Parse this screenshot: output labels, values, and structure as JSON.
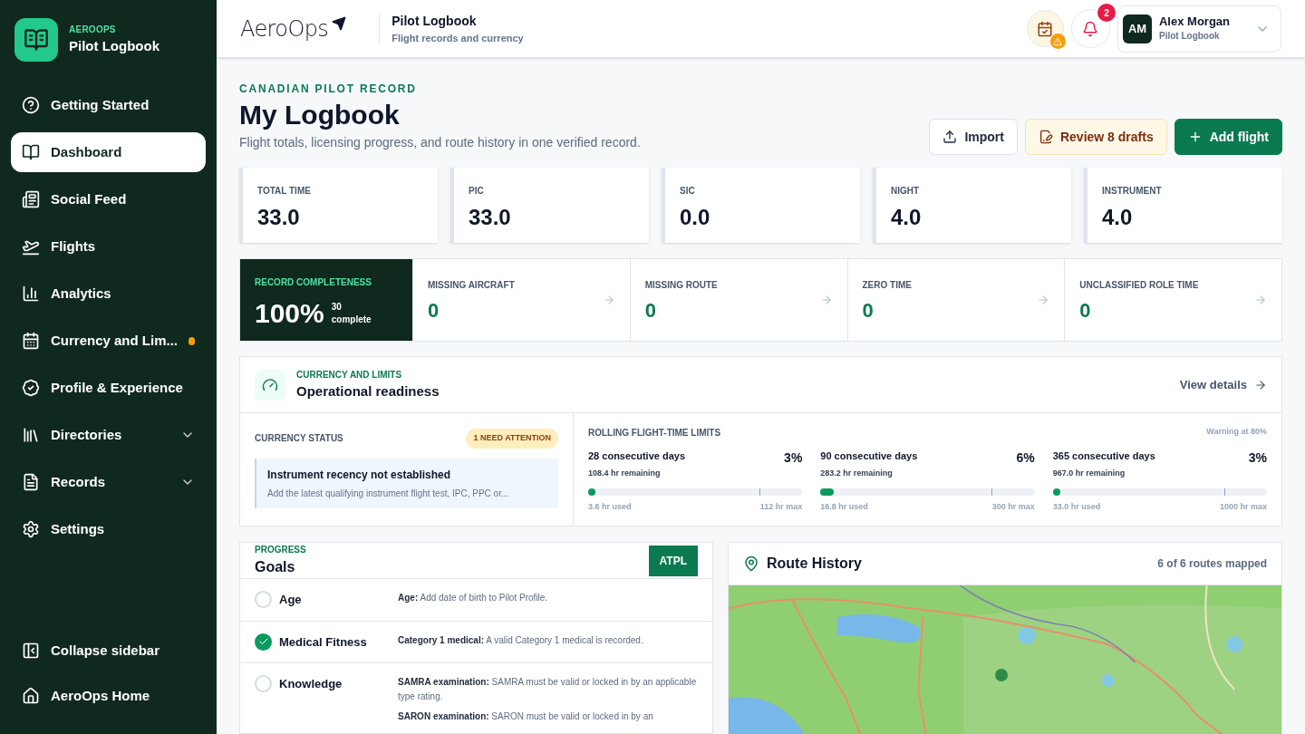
{
  "sidebar": {
    "brand": {
      "eyebrow": "AEROOPS",
      "title": "Pilot Logbook"
    },
    "items": [
      {
        "label": "Getting Started",
        "selected": false
      },
      {
        "label": "Dashboard",
        "selected": true
      },
      {
        "label": "Social Feed",
        "selected": false
      },
      {
        "label": "Flights",
        "selected": false
      },
      {
        "label": "Analytics",
        "selected": false
      },
      {
        "label": "Currency and Lim...",
        "selected": false,
        "alert": true
      },
      {
        "label": "Profile & Experience",
        "selected": false
      },
      {
        "label": "Directories",
        "selected": false,
        "expandable": true
      },
      {
        "label": "Records",
        "selected": false,
        "expandable": true
      },
      {
        "label": "Settings",
        "selected": false
      }
    ],
    "footer": [
      {
        "label": "Collapse sidebar"
      },
      {
        "label": "AeroOps Home"
      }
    ]
  },
  "header": {
    "logo": "AeroOps",
    "title": "Pilot Logbook",
    "subtitle": "Flight records and currency",
    "notifications": "2",
    "user": {
      "initials": "AM",
      "name": "Alex Morgan",
      "role": "Pilot Logbook"
    }
  },
  "page": {
    "eyebrow": "CANADIAN PILOT RECORD",
    "title": "My Logbook",
    "subtitle": "Flight totals, licensing progress, and route history in one verified record.",
    "buttons": [
      {
        "label": "Import",
        "kind": "outline"
      },
      {
        "label": "Review 8 drafts",
        "kind": "warning"
      },
      {
        "label": "Add flight",
        "kind": "primary"
      }
    ]
  },
  "totals": [
    {
      "label": "TOTAL TIME",
      "value": "33.0"
    },
    {
      "label": "PIC",
      "value": "33.0"
    },
    {
      "label": "SIC",
      "value": "0.0"
    },
    {
      "label": "NIGHT",
      "value": "4.0"
    },
    {
      "label": "INSTRUMENT",
      "value": "4.0"
    }
  ],
  "completeness": {
    "label": "RECORD COMPLETENESS",
    "value": "100%",
    "count": "30",
    "count_label": "complete"
  },
  "issues": [
    {
      "label": "MISSING AIRCRAFT",
      "value": "0"
    },
    {
      "label": "MISSING ROUTE",
      "value": "0"
    },
    {
      "label": "ZERO TIME",
      "value": "0"
    },
    {
      "label": "UNCLASSIFIED ROLE TIME",
      "value": "0"
    }
  ],
  "readiness": {
    "eyebrow": "CURRENCY AND LIMITS",
    "title": "Operational readiness",
    "link": "View details",
    "currency": {
      "label": "CURRENCY STATUS",
      "badge": "1 NEED ATTENTION",
      "alert": {
        "title": "Instrument recency not established",
        "text": "Add the latest qualifying instrument flight test, IPC, PPC or..."
      }
    },
    "limits": {
      "label": "ROLLING FLIGHT-TIME LIMITS",
      "note": "Warning at 80%",
      "items": [
        {
          "title": "28 consecutive days",
          "percent": "3%",
          "remaining": "108.4 hr remaining",
          "level": 0.03,
          "used": "3.6 hr used",
          "max": "112 hr max"
        },
        {
          "title": "90 consecutive days",
          "percent": "6%",
          "remaining": "283.2 hr remaining",
          "level": 0.06,
          "used": "16.8 hr used",
          "max": "300 hr max"
        },
        {
          "title": "365 consecutive days",
          "percent": "3%",
          "remaining": "967.0 hr remaining",
          "level": 0.03,
          "used": "33.0 hr used",
          "max": "1000 hr max"
        }
      ]
    }
  },
  "goals": {
    "eyebrow": "PROGRESS",
    "title": "Goals",
    "badge": "ATPL",
    "rows": [
      {
        "label": "Age",
        "checked": false,
        "details": [
          "**Age:** Add date of birth to Pilot Profile."
        ]
      },
      {
        "label": "Medical Fitness",
        "checked": true,
        "details": [
          "**Category 1 medical:** A valid Category 1 medical is recorded."
        ]
      },
      {
        "label": "Knowledge",
        "checked": false,
        "details": [
          "**SAMRA examination:** SAMRA must be valid or locked in by an applicable type rating.",
          "**SARON examination:** SARON must be valid or locked in by an"
        ]
      }
    ]
  },
  "routes": {
    "title": "Route History",
    "summary": "6 of 6 routes mapped"
  }
}
